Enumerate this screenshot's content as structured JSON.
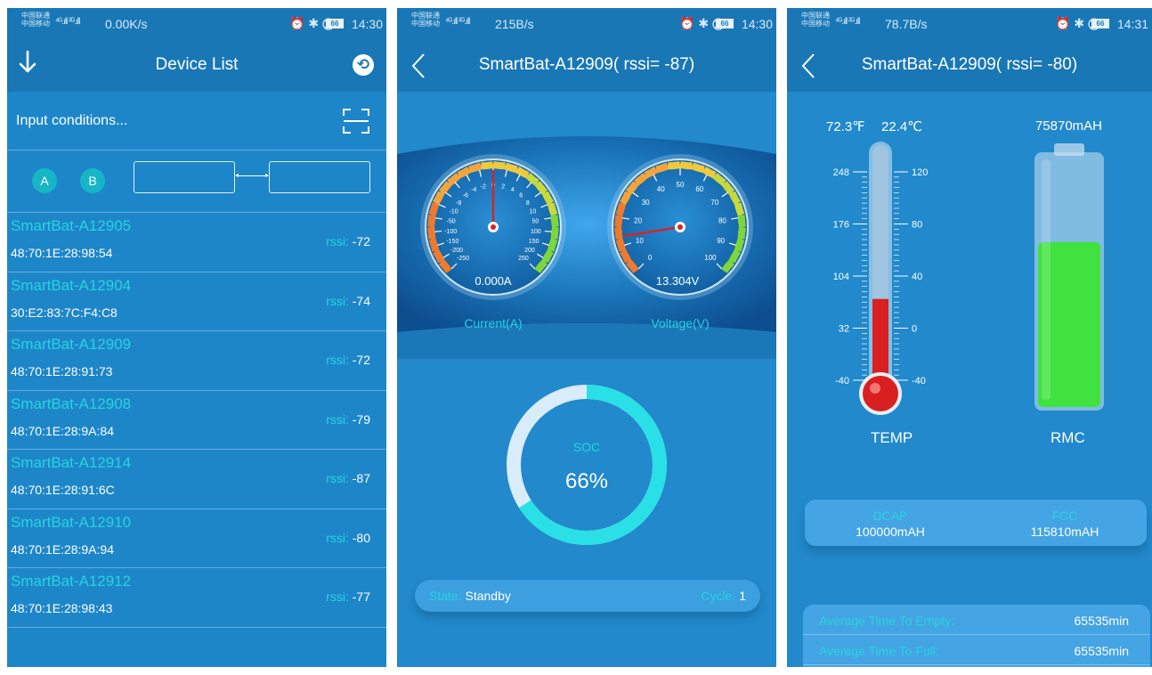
{
  "colors": {
    "bar": "#1977b6",
    "panel_bg": "#1d86c9",
    "accent": "#27d3df",
    "soc_ring": "#29e0e6",
    "battery_fill": "#3fe23f",
    "thermo_red": "#d91f1f"
  },
  "icons": {
    "back": "down-arrow-icon",
    "refresh": "refresh-icon",
    "scan": "scan-icon",
    "nav_back": "chevron-left-icon",
    "alarm": "alarm-icon",
    "bluetooth": "bluetooth-icon",
    "mute": "bell-mute-icon"
  },
  "screens": [
    {
      "status": {
        "carrier_top": "中国联通",
        "carrier_bottom": "中国移动",
        "signal": "⁴ᴳ.ıll ²ᴳ.ıll",
        "speed": "0.00K/s",
        "icons": "⏰ ✱ ⨂",
        "battery": "66",
        "time": "14:30"
      },
      "title": "Device List",
      "search_placeholder": "Input conditions...",
      "btn_a": "A",
      "btn_b": "B",
      "rssi_label": "rssi:",
      "devices": [
        {
          "name": "SmartBat-A12905",
          "mac": "48:70:1E:28:98:54",
          "rssi": "-72"
        },
        {
          "name": "SmartBat-A12904",
          "mac": "30:E2:83:7C:F4:C8",
          "rssi": "-74"
        },
        {
          "name": "SmartBat-A12909",
          "mac": "48:70:1E:28:91:73",
          "rssi": "-72"
        },
        {
          "name": "SmartBat-A12908",
          "mac": "48:70:1E:28:9A:84",
          "rssi": "-79"
        },
        {
          "name": "SmartBat-A12914",
          "mac": "48:70:1E:28:91:6C",
          "rssi": "-87"
        },
        {
          "name": "SmartBat-A12910",
          "mac": "48:70:1E:28:9A:94",
          "rssi": "-80"
        },
        {
          "name": "SmartBat-A12912",
          "mac": "48:70:1E:28:98:43",
          "rssi": "-77"
        }
      ]
    },
    {
      "status": {
        "carrier_top": "中国联通",
        "carrier_bottom": "中国移动",
        "signal": "⁴ᴳ.ıll ²ᴳ.ıll",
        "speed": "215B/s",
        "icons": "⏰ ✱ ⨂",
        "battery": "66",
        "time": "14:30"
      },
      "title": "SmartBat-A12909( rssi= -87)",
      "current": {
        "value": "0.000A",
        "label": "Current(A)",
        "reading": 0,
        "ticks": [
          "-250",
          "-200",
          "-150",
          "-100",
          "-50",
          "-10",
          "-8",
          "-6",
          "-4",
          "-2",
          "0",
          "2",
          "4",
          "6",
          "8",
          "10",
          "50",
          "100",
          "150",
          "200",
          "250"
        ]
      },
      "voltage": {
        "value": "13.304V",
        "label": "Voltage(V)",
        "reading": 13.304,
        "ticks": [
          "0",
          "10",
          "20",
          "30",
          "40",
          "50",
          "60",
          "70",
          "80",
          "90",
          "100"
        ]
      },
      "soc": {
        "label": "SOC",
        "value": "66%",
        "percent": 66
      },
      "state_label": "State:",
      "state_value": "Standby",
      "cycle_label": "Cycle:",
      "cycle_value": "1"
    },
    {
      "status": {
        "carrier_top": "中国联通",
        "carrier_bottom": "中国移动",
        "signal": "⁴ᴳ.ıll ²ᴳ.ıll",
        "speed": "78.7B/s",
        "icons": "⏰ ✱ ⨂",
        "battery": "66",
        "time": "14:31"
      },
      "title": "SmartBat-A12909( rssi= -80)",
      "temp_f": "72.3℉",
      "temp_c": "22.4℃",
      "rmc_value": "75870mAH",
      "temp_caption": "TEMP",
      "rmc_caption": "RMC",
      "thermo_f_ticks": [
        "248",
        "176",
        "104",
        "32",
        "-40"
      ],
      "thermo_c_ticks": [
        "120",
        "80",
        "40",
        "0",
        "-40"
      ],
      "thermo_level_c": 22.4,
      "battery_fill_fraction": 0.656,
      "dcap_label": "DCAP",
      "dcap_value": "100000mAH",
      "fcc_label": "FCC",
      "fcc_value": "115810mAH",
      "time_to_empty_label": "Average Time To Empty:",
      "time_to_empty_value": "65535min",
      "time_to_full_label": "Average Time To Full:",
      "time_to_full_value": "65535min"
    }
  ]
}
